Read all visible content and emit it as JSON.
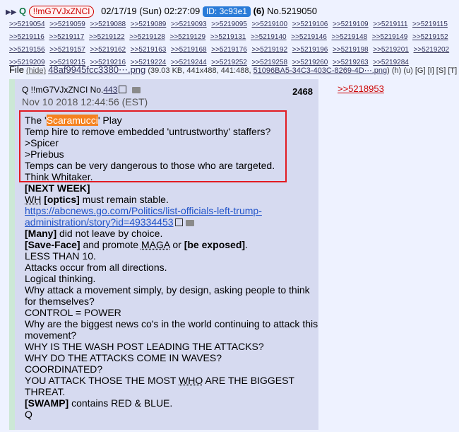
{
  "header": {
    "arrows": "▶▶",
    "name": "Q",
    "tripcode": "!!mG7VJxZNCI",
    "datetime": "02/17/19 (Sun) 02:27:09",
    "id_label": "ID: 3c93e1",
    "reply_count": "(6)",
    "post_no": "No.5219050"
  },
  "replies": [
    ">>5219054",
    ">>5219059",
    ">>5219088",
    ">>5219089",
    ">>5219093",
    ">>5219095",
    ">>5219100",
    ">>5219106",
    ">>5219109",
    ">>5219111",
    ">>5219115",
    ">>5219116",
    ">>5219117",
    ">>5219122",
    ">>5219128",
    ">>5219129",
    ">>5219131",
    ">>5219140",
    ">>5219146",
    ">>5219148",
    ">>5219149",
    ">>5219152",
    ">>5219156",
    ">>5219157",
    ">>5219162",
    ">>5219163",
    ">>5219168",
    ">>5219176",
    ">>5219192",
    ">>5219196",
    ">>5219198",
    ">>5219201",
    ">>5219202",
    ">>5219209",
    ">>5219215",
    ">>5219216",
    ">>5219224",
    ">>5219244",
    ">>5219252",
    ">>5219258",
    ">>5219260",
    ">>5219263",
    ">>5219284"
  ],
  "file": {
    "label": "File",
    "hide": "(hide)",
    "filename": "48af9945fcc3380⋯.png",
    "meta": "(39.03 KB, 441x488, 441:488,",
    "original": "51096BA5-34C3-403C-8269-4D⋯.png",
    "tail": ") (h) (u) [G] [I] [S] [T] [K]"
  },
  "inner": {
    "author": "Q !!mG7VJxZNCI No.",
    "post_link": "443",
    "date": "Nov 10 2018 12:44:56 (EST)",
    "number": "2468"
  },
  "body": {
    "l1a": "The '",
    "l1h": "Scaramucci",
    "l1b": "' Play",
    "l2": "Temp hire to remove embedded 'untrustworthy' staffers?",
    "l3": ">Spicer",
    "l4": ">Priebus",
    "l5": "Temps can be very dangerous to those who are targeted.",
    "l6": "Think Whitaker.",
    "l7": "[NEXT WEEK]",
    "l8a": "WH",
    "l8b": "[optics]",
    "l8c": " must remain stable.",
    "l9": "https://abcnews.go.com/Politics/list-officials-left-trump-administration/story?id=49334453",
    "l10a": "[Many]",
    "l10b": " did not leave by choice.",
    "l11a": "[Save-Face]",
    "l11b": " and promote ",
    "l11c": "MAGA",
    "l11d": " or ",
    "l11e": "[be exposed]",
    "l11f": ".",
    "l12": "LESS THAN 10.",
    "l13": "Attacks occur from all directions.",
    "l14": "Logical thinking.",
    "l15": "Why attack a movement simply, by design, asking people to think for themselves?",
    "l16": "CONTROL = POWER",
    "l17": "Why are the biggest news co's in the world continuing to attack this movement?",
    "l18": "WHY IS THE WASH POST LEADING THE ATTACKS?",
    "l19": "WHY DO THE ATTACKS COME IN WAVES?",
    "l20": "COORDINATED?",
    "l21a": "YOU ATTACK THOSE THE MOST ",
    "l21b": "WHO",
    "l21c": " ARE THE BIGGEST THREAT.",
    "l22a": "[SWAMP]",
    "l22b": " contains RED & BLUE.",
    "l23": "Q"
  },
  "backlink": ">>5218953"
}
